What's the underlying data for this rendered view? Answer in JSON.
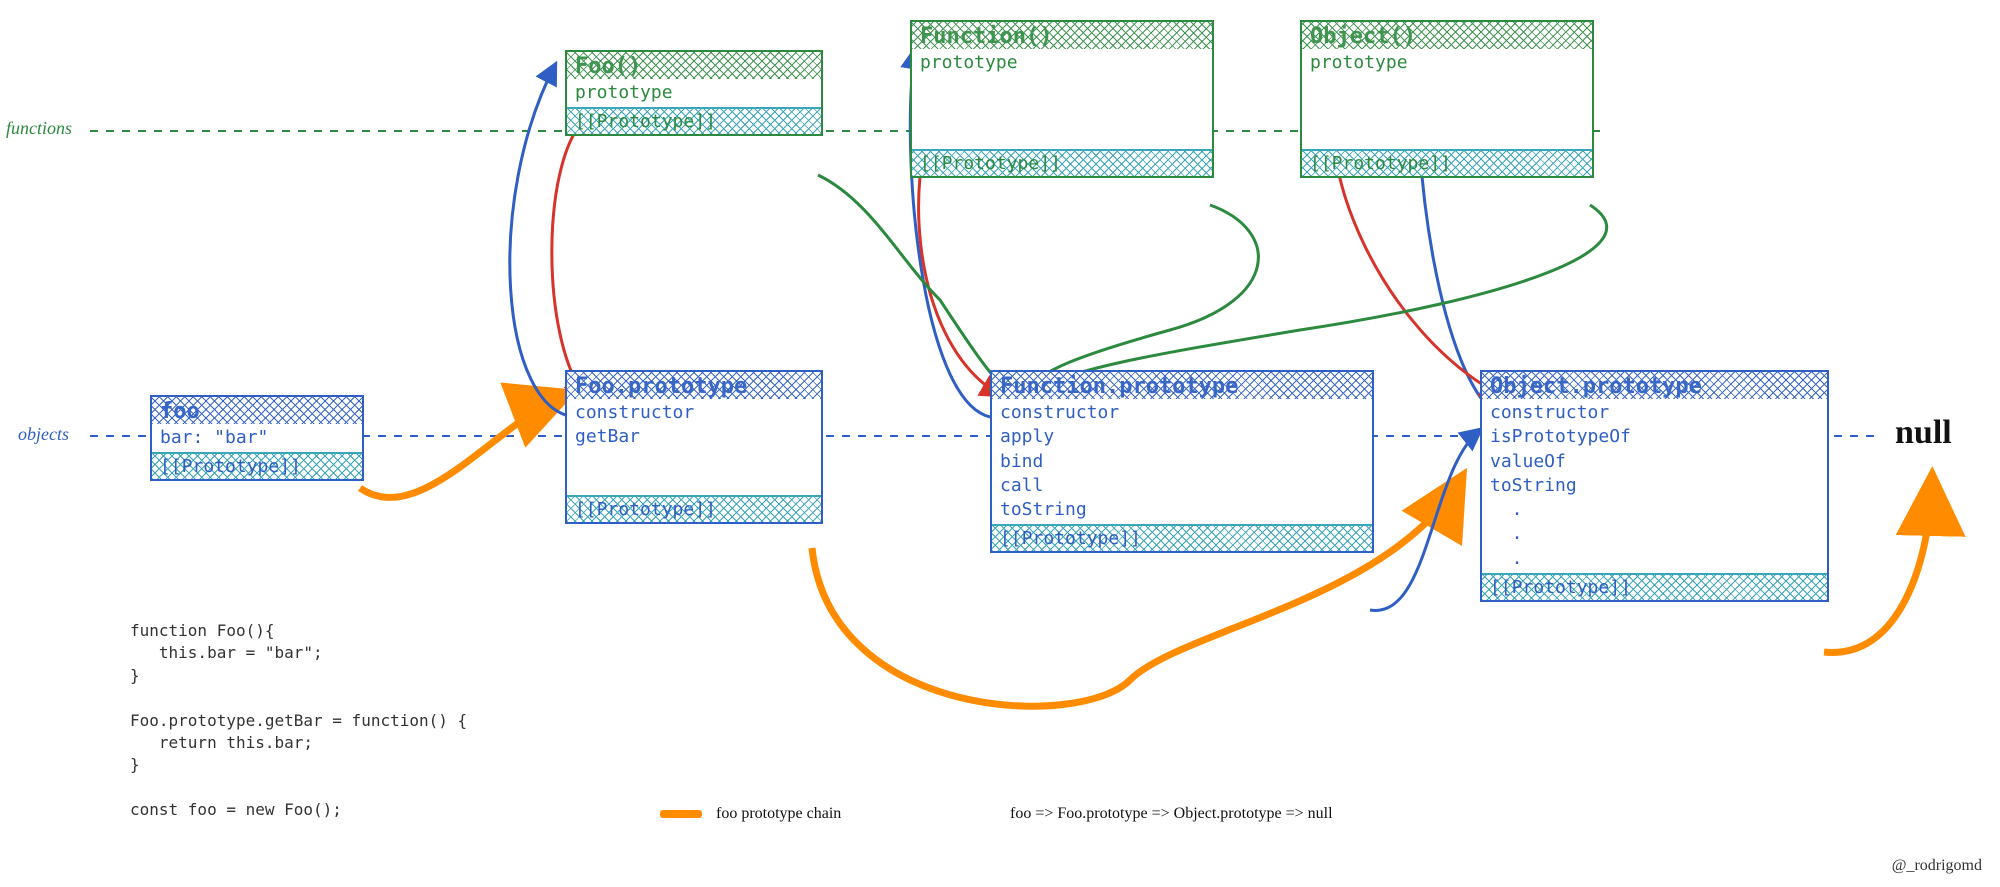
{
  "rows": {
    "functions_label": "functions",
    "objects_label": "objects"
  },
  "boxes": {
    "foo_ctor": {
      "title": "Foo()",
      "body": "prototype",
      "slot": "[[Prototype]]"
    },
    "function_ctor": {
      "title": "Function()",
      "body": "prototype",
      "slot": "[[Prototype]]"
    },
    "object_ctor": {
      "title": "Object()",
      "body": "prototype",
      "slot": "[[Prototype]]"
    },
    "foo_inst": {
      "title": "foo",
      "body": "bar: \"bar\"",
      "slot": "[[Prototype]]"
    },
    "foo_proto": {
      "title": "Foo.prototype",
      "body": "constructor\ngetBar",
      "slot": "[[Prototype]]"
    },
    "function_proto": {
      "title": "Function.prototype",
      "body": "constructor\napply\nbind\ncall\ntoString",
      "slot": "[[Prototype]]"
    },
    "object_proto": {
      "title": "Object.prototype",
      "body": "constructor\nisPrototypeOf\nvalueOf\ntoString\n  .\n  .\n  .",
      "slot": "[[Prototype]]"
    }
  },
  "null_text": "null",
  "code": "function Foo(){\n   this.bar = \"bar\";\n}\n\nFoo.prototype.getBar = function() {\n   return this.bar;\n}\n\nconst foo = new Foo();",
  "legend": {
    "swatch_label": "foo prototype chain",
    "chain_text": "foo => Foo.prototype => Object.prototype => null"
  },
  "credit": "@_rodrigomd"
}
